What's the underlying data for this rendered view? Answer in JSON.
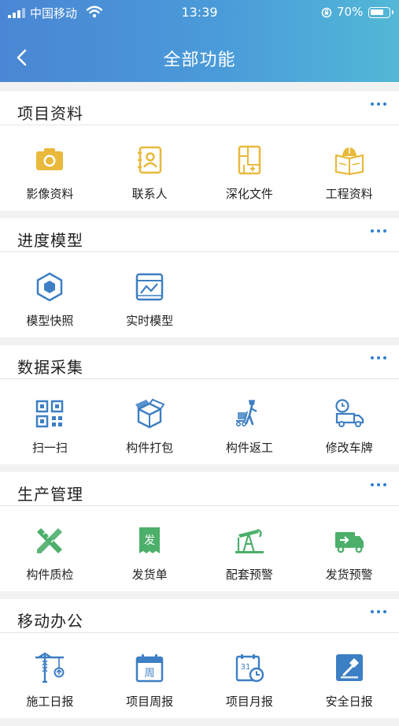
{
  "status": {
    "carrier": "中国移动",
    "time": "13:39",
    "battery": "70%"
  },
  "header": {
    "title": "全部功能"
  },
  "sections": [
    {
      "title": "项目资料",
      "items": [
        {
          "label": "影像资料",
          "icon": "camera-icon"
        },
        {
          "label": "联系人",
          "icon": "contact-icon"
        },
        {
          "label": "深化文件",
          "icon": "blueprint-file-icon"
        },
        {
          "label": "工程资料",
          "icon": "engineering-book-icon"
        }
      ]
    },
    {
      "title": "进度模型",
      "items": [
        {
          "label": "模型快照",
          "icon": "model-snapshot-icon"
        },
        {
          "label": "实时模型",
          "icon": "realtime-model-icon"
        }
      ]
    },
    {
      "title": "数据采集",
      "items": [
        {
          "label": "扫一扫",
          "icon": "qr-scan-icon"
        },
        {
          "label": "构件打包",
          "icon": "package-box-icon"
        },
        {
          "label": "构件返工",
          "icon": "worker-cart-icon"
        },
        {
          "label": "修改车牌",
          "icon": "truck-clock-icon"
        }
      ]
    },
    {
      "title": "生产管理",
      "items": [
        {
          "label": "构件质检",
          "icon": "ruler-pencil-icon",
          "glyph": ""
        },
        {
          "label": "发货单",
          "icon": "delivery-receipt-icon",
          "glyph": "发"
        },
        {
          "label": "配套预警",
          "icon": "oil-pump-icon",
          "glyph": ""
        },
        {
          "label": "发货预警",
          "icon": "delivery-truck-icon",
          "glyph": ""
        }
      ]
    },
    {
      "title": "移动办公",
      "items": [
        {
          "label": "施工日报",
          "icon": "crane-icon",
          "glyph": ""
        },
        {
          "label": "项目周报",
          "icon": "weekly-calendar-icon",
          "glyph": "周"
        },
        {
          "label": "项目月报",
          "icon": "monthly-calendar-icon",
          "glyph": "31"
        },
        {
          "label": "安全日报",
          "icon": "safety-hammer-icon",
          "glyph": ""
        }
      ]
    }
  ],
  "colors": {
    "header_gradient_start": "#4a86d4",
    "header_gradient_end": "#52b8d6",
    "yellow_icon": "#e8b93a",
    "blue_icon": "#3d7fc4",
    "green_icon": "#4caf6a",
    "more_dots": "#2f7fd0"
  }
}
